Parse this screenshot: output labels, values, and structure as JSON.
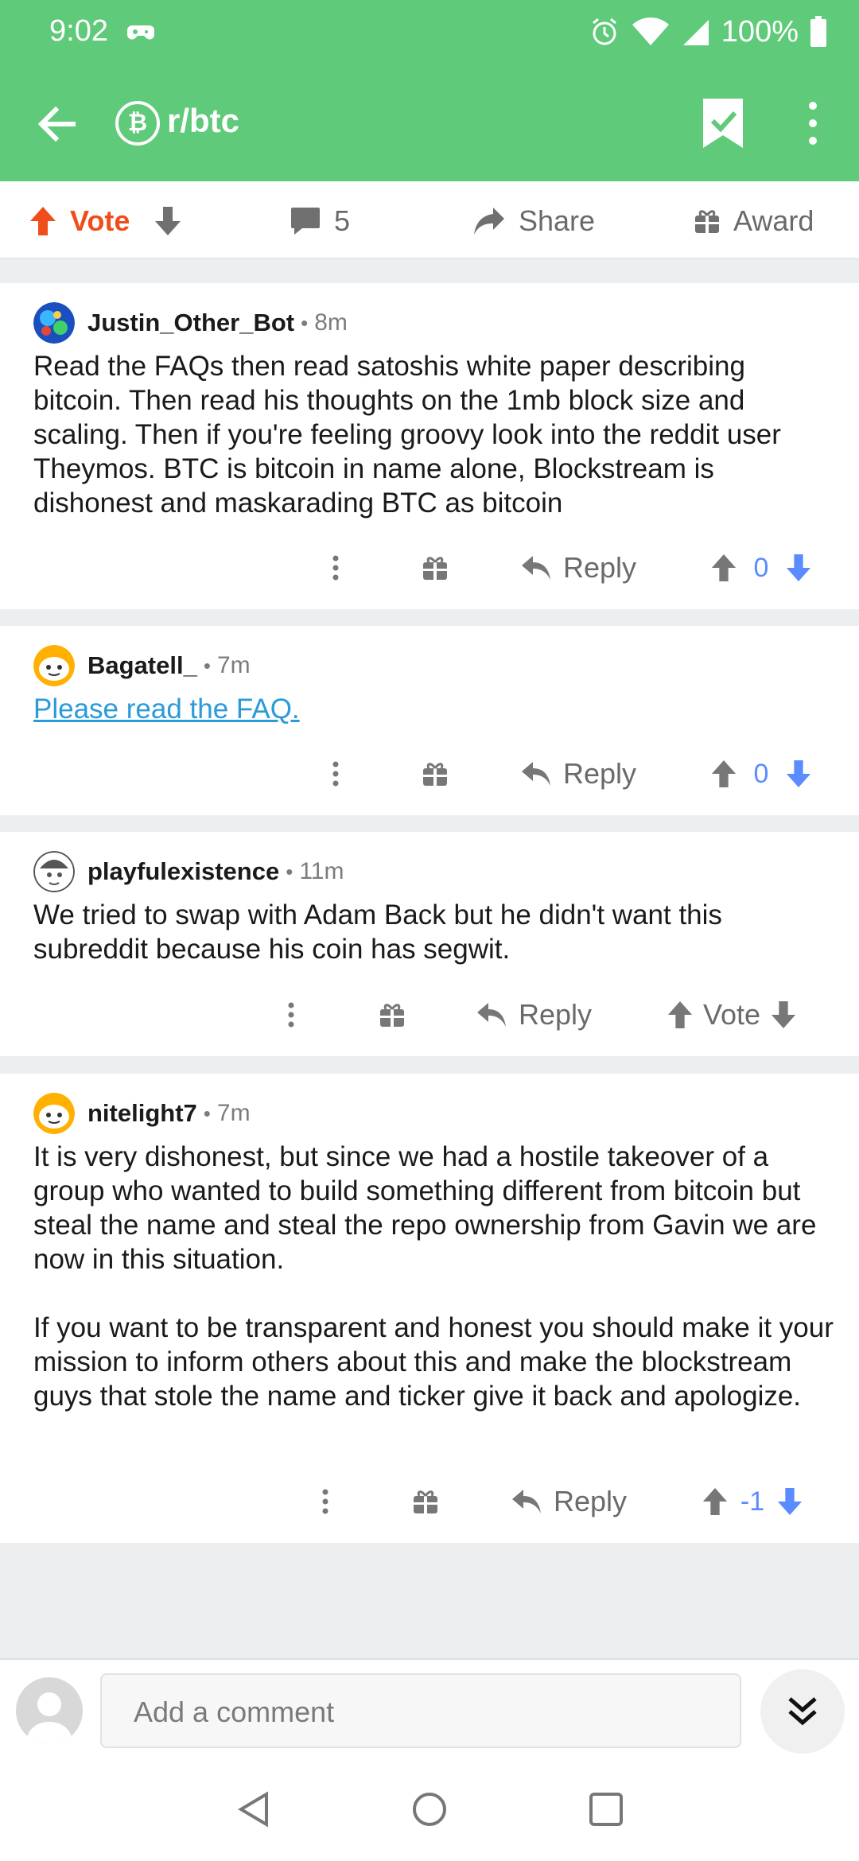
{
  "status": {
    "time": "9:02",
    "battery": "100%"
  },
  "header": {
    "subreddit": "r/btc"
  },
  "post_actions": {
    "vote_label": "Vote",
    "comments_count": "5",
    "share_label": "Share",
    "award_label": "Award"
  },
  "comments": [
    {
      "author": "Justin_Other_Bot",
      "age": "8m",
      "paragraphs": [
        "Read the FAQs then read satoshis white paper describing bitcoin. Then read his thoughts on the 1mb block size and scaling. Then if you're feeling groovy look into the reddit user Theymos. BTC is bitcoin in name alone, Blockstream is dishonest and maskarading BTC as bitcoin"
      ],
      "reply_label": "Reply",
      "score": "0"
    },
    {
      "author": "Bagatell_",
      "age": "7m",
      "link_text": "Please read the FAQ.",
      "reply_label": "Reply",
      "score": "0"
    },
    {
      "author": "playfulexistence",
      "age": "11m",
      "paragraphs": [
        "We tried to swap with Adam Back but he didn't want this subreddit because his coin has segwit."
      ],
      "reply_label": "Reply",
      "vote_label": "Vote"
    },
    {
      "author": "nitelight7",
      "age": "7m",
      "paragraphs": [
        "It is very dishonest, but since we had a hostile takeover of a group who wanted to build something different from bitcoin but steal the name and steal the repo ownership from Gavin we are now in this situation.",
        "If you want to be transparent and honest you should make it your mission to inform others about this and make the blockstream guys that stole the name and ticker give it back and apologize."
      ],
      "reply_label": "Reply",
      "score": "-1"
    }
  ],
  "composer": {
    "placeholder": "Add a comment"
  },
  "colors": {
    "app_bar": "#5fca79",
    "upvote_orange": "#f04d1d",
    "vote_blue": "#5b8cff",
    "link": "#2a9ad8"
  }
}
